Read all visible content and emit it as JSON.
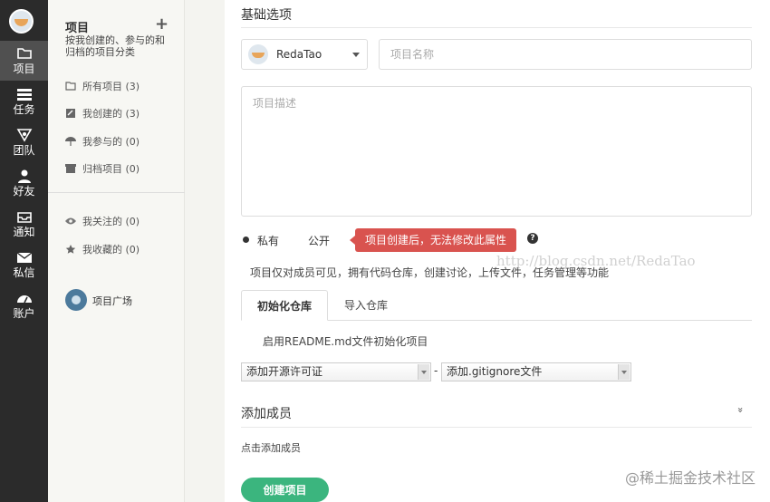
{
  "nav": {
    "items": [
      {
        "label": "项目",
        "icon": "folder-icon"
      },
      {
        "label": "任务",
        "icon": "tasks-icon"
      },
      {
        "label": "团队",
        "icon": "team-icon"
      },
      {
        "label": "好友",
        "icon": "user-icon"
      },
      {
        "label": "通知",
        "icon": "inbox-icon"
      },
      {
        "label": "私信",
        "icon": "mail-icon"
      },
      {
        "label": "账户",
        "icon": "dashboard-icon"
      }
    ]
  },
  "sidebar": {
    "title": "项目",
    "add_symbol": "+",
    "description": "按我创建的、参与的和归档的项目分类",
    "filters": [
      {
        "label": "所有项目 (3)",
        "icon": "folder-open-icon"
      },
      {
        "label": "我创建的 (3)",
        "icon": "edit-icon"
      },
      {
        "label": "我参与的 (0)",
        "icon": "umbrella-icon"
      },
      {
        "label": "归档项目 (0)",
        "icon": "archive-icon"
      }
    ],
    "social": [
      {
        "label": "我关注的 (0)",
        "icon": "eye-icon"
      },
      {
        "label": "我收藏的 (0)",
        "icon": "star-icon"
      }
    ],
    "square_label": "项目广场"
  },
  "form": {
    "section_title": "基础选项",
    "owner_name": "RedaTao",
    "project_name_placeholder": "项目名称",
    "project_desc_placeholder": "项目描述",
    "private_label": "私有",
    "public_label": "公开",
    "tooltip": "项目创建后，无法修改此属性",
    "help_symbol": "?",
    "visibility_hint": "项目仅对成员可见，拥有代码仓库，创建讨论，上传文件，任务管理等功能",
    "watermark": "http://blog.csdn.net/RedaTao",
    "tabs": [
      "初始化仓库",
      "导入仓库"
    ],
    "readme_label": "启用README.md文件初始化项目",
    "license_select": "添加开源许可证",
    "separator": "-",
    "gitignore_select": "添加.gitignore文件",
    "members_title": "添加成员",
    "collapse_symbol": "»",
    "add_members_link": "点击添加成员",
    "create_button": "创建项目"
  },
  "brandmark": "@稀土掘金技术社区",
  "colors": {
    "nav_bg": "#2b2b2b",
    "accent_green": "#3bb57e",
    "tooltip_red": "#d9534f"
  }
}
